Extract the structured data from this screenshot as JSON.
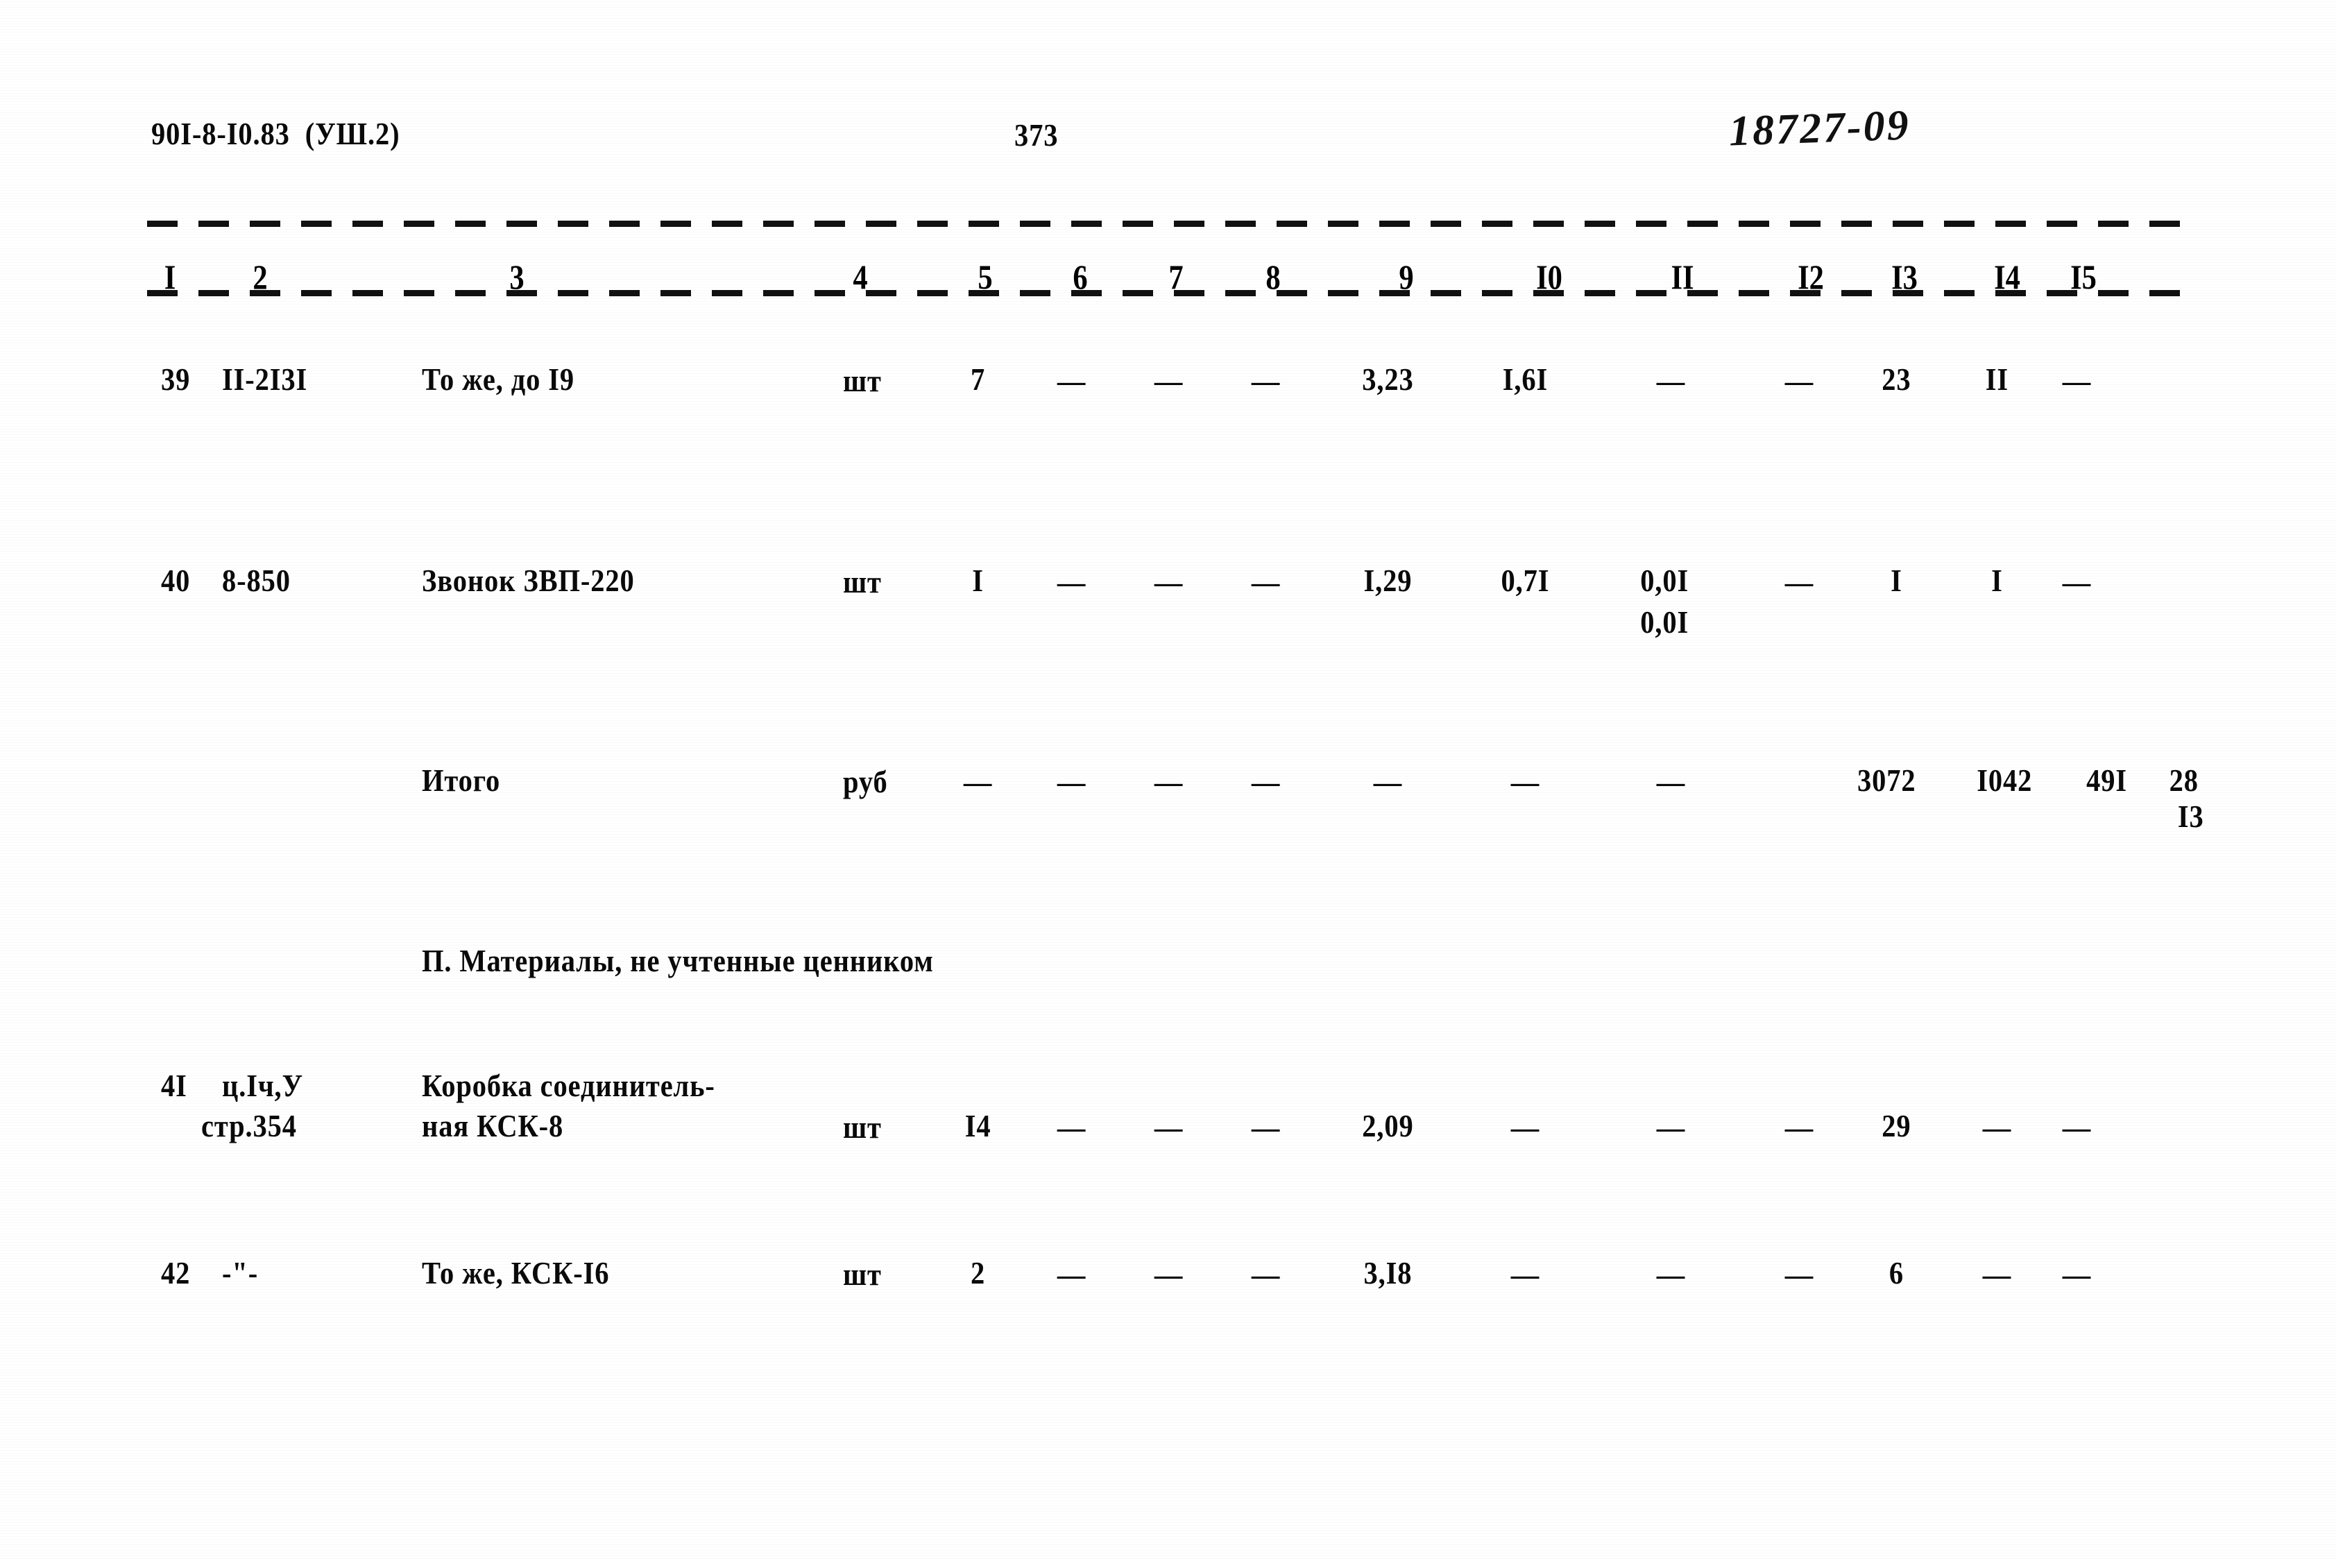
{
  "document": {
    "header_left": "90I-8-I0.83  (УШ.2)",
    "page_number": "373",
    "handwritten_note": "18727-09"
  },
  "table": {
    "column_numbers": [
      "I",
      "2",
      "3",
      "4",
      "5",
      "6",
      "7",
      "8",
      "9",
      "I0",
      "II",
      "I2",
      "I3",
      "I4",
      "I5"
    ],
    "dash_glyph": "—",
    "rows": [
      {
        "row_name": "row-39",
        "num": "39",
        "code": "II-2I3I",
        "description": [
          "То же, до I9"
        ],
        "unit": "шт",
        "c5": "7",
        "c6": "—",
        "c7": "—",
        "c8": "—",
        "c9": "3,23",
        "c10": "I,6I",
        "c11": "—",
        "c12": "—",
        "c13": "23",
        "c14": "II",
        "c15": "—"
      },
      {
        "row_name": "row-40",
        "num": "40",
        "code": "8-850",
        "description": [
          "Звонок ЗВП-220"
        ],
        "unit": "шт",
        "c5": "I",
        "c6": "—",
        "c7": "—",
        "c8": "—",
        "c9": "I,29",
        "c10": "0,7I",
        "c11": "0,0I",
        "c11b": "0,0I",
        "c12": "—",
        "c13": "I",
        "c14": "I",
        "c15": "—"
      },
      {
        "row_name": "row-itogo",
        "num": "",
        "code": "",
        "description": [
          "Итого"
        ],
        "unit": "руб",
        "c5": "—",
        "c6": "—",
        "c7": "—",
        "c8": "—",
        "c9": "—",
        "c10": "—",
        "c11": "—",
        "c12": "3072",
        "c13": "I042",
        "c14": "49I",
        "c15": "28",
        "c15b": "I3"
      },
      {
        "row_name": "row-41",
        "num": "4I",
        "code": "ц.Iч,У",
        "code2": "стр.354",
        "description": [
          "Коробка соединитель-",
          "ная КСК-8"
        ],
        "unit": "шт",
        "c5": "I4",
        "c6": "—",
        "c7": "—",
        "c8": "—",
        "c9": "2,09",
        "c10": "—",
        "c11": "—",
        "c12": "—",
        "c13": "29",
        "c14": "—",
        "c15": "—"
      },
      {
        "row_name": "row-42",
        "num": "42",
        "code": "-\"-",
        "description": [
          "То же, КСК-I6"
        ],
        "unit": "шт",
        "c5": "2",
        "c6": "—",
        "c7": "—",
        "c8": "—",
        "c9": "3,I8",
        "c10": "—",
        "c11": "—",
        "c12": "—",
        "c13": "6",
        "c14": "—",
        "c15": "—"
      }
    ],
    "section_heading": "П. Материалы, не учтенные ценником"
  }
}
